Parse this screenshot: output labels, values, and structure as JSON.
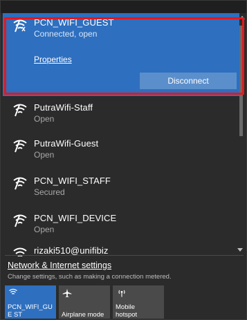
{
  "active_network": {
    "name": "PCN_WIFI_GUEST",
    "status": "Connected, open",
    "properties_label": "Properties",
    "disconnect_label": "Disconnect"
  },
  "networks": [
    {
      "name": "PutraWifi-Staff",
      "status": "Open",
      "icon": "wifi-open-icon"
    },
    {
      "name": "PutraWifi-Guest",
      "status": "Open",
      "icon": "wifi-open-icon"
    },
    {
      "name": "PCN_WIFI_STAFF",
      "status": "Secured",
      "icon": "wifi-secured-icon"
    },
    {
      "name": "PCN_WIFI_DEVICE",
      "status": "Open",
      "icon": "wifi-open-icon"
    },
    {
      "name": "rizaki510@unifibiz",
      "status": "",
      "icon": "wifi-secured-icon"
    }
  ],
  "settings": {
    "link_label": "Network & Internet settings",
    "description": "Change settings, such as making a connection metered."
  },
  "quick_actions": [
    {
      "label": "PCN_WIFI_GUE ST",
      "icon": "wifi-icon",
      "active": true
    },
    {
      "label": "Airplane mode",
      "icon": "airplane-icon",
      "active": false
    },
    {
      "label": "Mobile hotspot",
      "icon": "hotspot-icon",
      "active": false
    }
  ],
  "colors": {
    "accent": "#2e6fbf",
    "panel_background": "#2b2b2b",
    "highlight_border": "#e8161b"
  }
}
